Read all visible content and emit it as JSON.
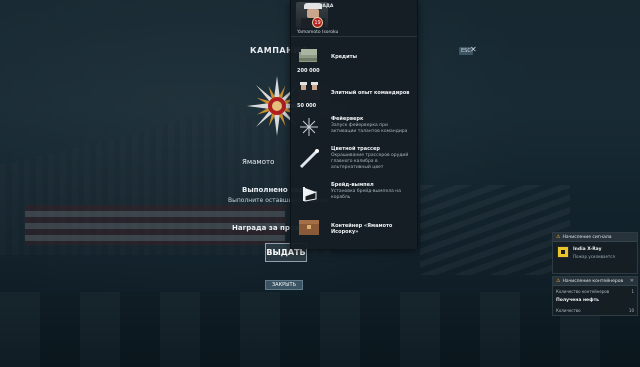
{
  "campaign": {
    "title": "КАМПАНИЯ",
    "esc_badge": "ESC",
    "close_glyph": "✕",
    "name": "Ямамото",
    "done_title": "Выполнено зад",
    "done_sub": "Выполните оставшиеся задани",
    "reward_title": "Награда за прохож",
    "claim_label": "ВЫДАТЬ",
    "close_label": "ЗАКРЫТЬ"
  },
  "rewards": {
    "header_tag": "НАГРАДА",
    "commander_name": "Yamamoto Isoroku",
    "commander_level": "19",
    "items": [
      {
        "title": "Кредиты",
        "desc": "",
        "qty": "200 000",
        "icon": "credits-icon"
      },
      {
        "title": "Элитный опыт командиров",
        "desc": "",
        "qty": "50 000",
        "icon": "commanders-icon"
      },
      {
        "title": "Фейерверк",
        "desc": "Запуск фейерверка при активации талантов командира",
        "qty": "",
        "icon": "firework-icon"
      },
      {
        "title": "Цветной трассер",
        "desc": "Окрашивание трассеров орудий главного калибра в альтернативный цвет",
        "qty": "",
        "icon": "tracer-icon"
      },
      {
        "title": "Брейд-вымпел",
        "desc": "Установка брейд-вымпела на корабль",
        "qty": "",
        "icon": "pennant-icon"
      },
      {
        "title": "Контейнер «Ямамото Исороку»",
        "desc": "",
        "qty": "",
        "icon": "container-icon"
      }
    ]
  },
  "notifications": [
    {
      "header": "Начисление сигнала",
      "title": "India X-Ray",
      "sub": "Пожар усиливается"
    },
    {
      "header": "Начисление контейнеров",
      "row_label": "Количество контейнеров",
      "row_value": "1",
      "strong": "Получена нефть",
      "row2_label": "Количество",
      "row2_value": "10"
    }
  ],
  "colors": {
    "accent_warn": "#f2b43b",
    "panel_bg": "#161e24",
    "level_badge": "#b3201f"
  }
}
